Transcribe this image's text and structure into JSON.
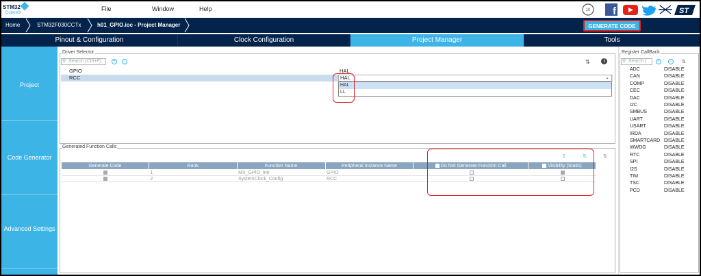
{
  "app": {
    "logo_text": "STM32",
    "logo_sub": "CubeMX"
  },
  "menu": [
    "File",
    "Window",
    "Help"
  ],
  "breadcrumb": [
    "Home",
    "STM32F030CCTx",
    "h01_GPIO.ioc - Project Manager"
  ],
  "generate_code": "GENERATE CODE",
  "tabs": [
    "Pinout & Configuration",
    "Clock Configuration",
    "Project Manager",
    "Tools"
  ],
  "sidebar": [
    "Project",
    "Code Generator",
    "Advanced Settings"
  ],
  "driver_selector": {
    "title": "Driver Selector",
    "search_placeholder": "Search (Ctrl+F)",
    "rows": [
      {
        "name": "GPIO",
        "value": "HAL"
      },
      {
        "name": "RCC",
        "value": "HAL"
      }
    ],
    "dropdown_options": [
      "HAL",
      "LL"
    ]
  },
  "generated_calls": {
    "title": "Generated Function Calls",
    "headers": [
      "Generate Code",
      "Rank",
      "Function Name",
      "Peripheral Instance Name",
      "Do Not Generate Function Call",
      "Visibility (Static)"
    ],
    "rows": [
      {
        "rank": "1",
        "function": "MX_GPIO_Init",
        "instance": "GPIO"
      },
      {
        "rank": "2",
        "function": "SystemClock_Config",
        "instance": "RCC"
      }
    ]
  },
  "register_callback": {
    "title": "Register CallBack",
    "search_placeholder": "Search (",
    "rows": [
      [
        "ADC",
        "DISABLE"
      ],
      [
        "CAN",
        "DISABLE"
      ],
      [
        "COMP",
        "DISABLE"
      ],
      [
        "CEC",
        "DISABLE"
      ],
      [
        "DAC",
        "DISABLE"
      ],
      [
        "I2C",
        "DISABLE"
      ],
      [
        "SMBUS",
        "DISABLE"
      ],
      [
        "UART",
        "DISABLE"
      ],
      [
        "USART",
        "DISABLE"
      ],
      [
        "IRDA",
        "DISABLE"
      ],
      [
        "SMARTCARD",
        "DISABLE"
      ],
      [
        "WWDG",
        "DISABLE"
      ],
      [
        "RTC",
        "DISABLE"
      ],
      [
        "SPI",
        "DISABLE"
      ],
      [
        "I2S",
        "DISABLE"
      ],
      [
        "TIM",
        "DISABLE"
      ],
      [
        "TSC",
        "DISABLE"
      ],
      [
        "PCD",
        "DISABLE"
      ]
    ]
  },
  "colors": {
    "navy": "#03234b",
    "accent": "#3cb4e6",
    "highlight": "#e02020"
  }
}
